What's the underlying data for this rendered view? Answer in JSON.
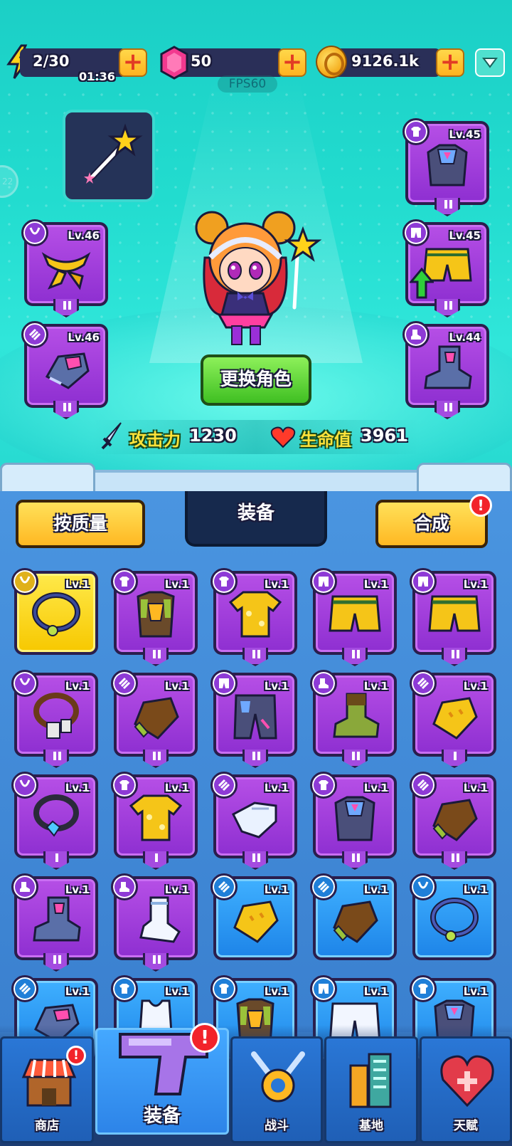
{
  "resources": {
    "energy": "2/30",
    "energy_timer": "01:36",
    "gems": "50",
    "gold": "9126.1k",
    "fps": "FPS60",
    "side_badge": "22"
  },
  "hero": {
    "change_label": "更换角色",
    "attack_label": "攻击力",
    "attack_value": "1230",
    "hp_label": "生命值",
    "hp_value": "3961"
  },
  "equipped": {
    "necklace": {
      "level": "Lv.46"
    },
    "gloves": {
      "level": "Lv.46"
    },
    "armor": {
      "level": "Lv.45"
    },
    "pants": {
      "level": "Lv.45"
    },
    "boots": {
      "level": "Lv.44"
    }
  },
  "inventory_header": {
    "sort_label": "按质量",
    "title": "装备",
    "merge_label": "合成",
    "merge_alert": "!"
  },
  "inventory": [
    {
      "level": "Lv.1",
      "type": "necklace-icon",
      "rarity": "gold",
      "item": "yellow-necklace"
    },
    {
      "level": "Lv.1",
      "type": "shirt-icon",
      "rarity": "purple",
      "item": "armor-vest"
    },
    {
      "level": "Lv.1",
      "type": "shirt-icon",
      "rarity": "purple",
      "item": "yellow-shirt"
    },
    {
      "level": "Lv.1",
      "type": "pants-icon",
      "rarity": "purple",
      "item": "yellow-shorts"
    },
    {
      "level": "Lv.1",
      "type": "pants-icon",
      "rarity": "purple",
      "item": "yellow-shorts"
    },
    {
      "level": "Lv.1",
      "type": "necklace-icon",
      "rarity": "purple",
      "item": "tag-necklace"
    },
    {
      "level": "Lv.1",
      "type": "glove-icon",
      "rarity": "purple",
      "item": "brown-glove"
    },
    {
      "level": "Lv.1",
      "type": "pants-icon",
      "rarity": "purple",
      "item": "mech-pants"
    },
    {
      "level": "Lv.1",
      "type": "boot-icon",
      "rarity": "purple",
      "item": "green-boot"
    },
    {
      "level": "Lv.1",
      "type": "glove-icon",
      "rarity": "purple",
      "item": "yellow-glove"
    },
    {
      "level": "Lv.1",
      "type": "necklace-icon",
      "rarity": "purple",
      "item": "blue-gem-necklace"
    },
    {
      "level": "Lv.1",
      "type": "shirt-icon",
      "rarity": "purple",
      "item": "yellow-shirt"
    },
    {
      "level": "Lv.1",
      "type": "glove-icon",
      "rarity": "purple",
      "item": "white-glove"
    },
    {
      "level": "Lv.1",
      "type": "shirt-icon",
      "rarity": "purple",
      "item": "mech-armor"
    },
    {
      "level": "Lv.1",
      "type": "glove-icon",
      "rarity": "purple",
      "item": "brown-glove"
    },
    {
      "level": "Lv.1",
      "type": "boot-icon",
      "rarity": "purple",
      "item": "mech-boot"
    },
    {
      "level": "Lv.1",
      "type": "boot-icon",
      "rarity": "purple",
      "item": "white-sock"
    },
    {
      "level": "Lv.1",
      "type": "glove-icon",
      "rarity": "blue",
      "item": "yellow-glove"
    },
    {
      "level": "Lv.1",
      "type": "glove-icon",
      "rarity": "blue",
      "item": "brown-glove"
    },
    {
      "level": "Lv.1",
      "type": "necklace-icon",
      "rarity": "blue",
      "item": "blue-necklace"
    },
    {
      "level": "Lv.1",
      "type": "glove-icon",
      "rarity": "blue",
      "item": "mech-glove"
    },
    {
      "level": "Lv.1",
      "type": "shirt-icon",
      "rarity": "blue",
      "item": "white-tank"
    },
    {
      "level": "Lv.1",
      "type": "shirt-icon",
      "rarity": "blue",
      "item": "armor-vest"
    },
    {
      "level": "Lv.1",
      "type": "pants-icon",
      "rarity": "blue",
      "item": "white-pants"
    },
    {
      "level": "Lv.1",
      "type": "shirt-icon",
      "rarity": "blue",
      "item": "mech-armor"
    }
  ],
  "nav": [
    {
      "label": "商店",
      "icon": "shop-icon",
      "alert": "!"
    },
    {
      "label": "装备",
      "icon": "gun-icon",
      "alert": "!",
      "active": true
    },
    {
      "label": "战斗",
      "icon": "battle-icon"
    },
    {
      "label": "基地",
      "icon": "base-icon"
    },
    {
      "label": "天赋",
      "icon": "talent-icon"
    }
  ],
  "colors": {
    "purple": "#9b3fe0",
    "gold": "#f7c800",
    "blue": "#2a8ff0",
    "accent": "#3fbf22"
  }
}
